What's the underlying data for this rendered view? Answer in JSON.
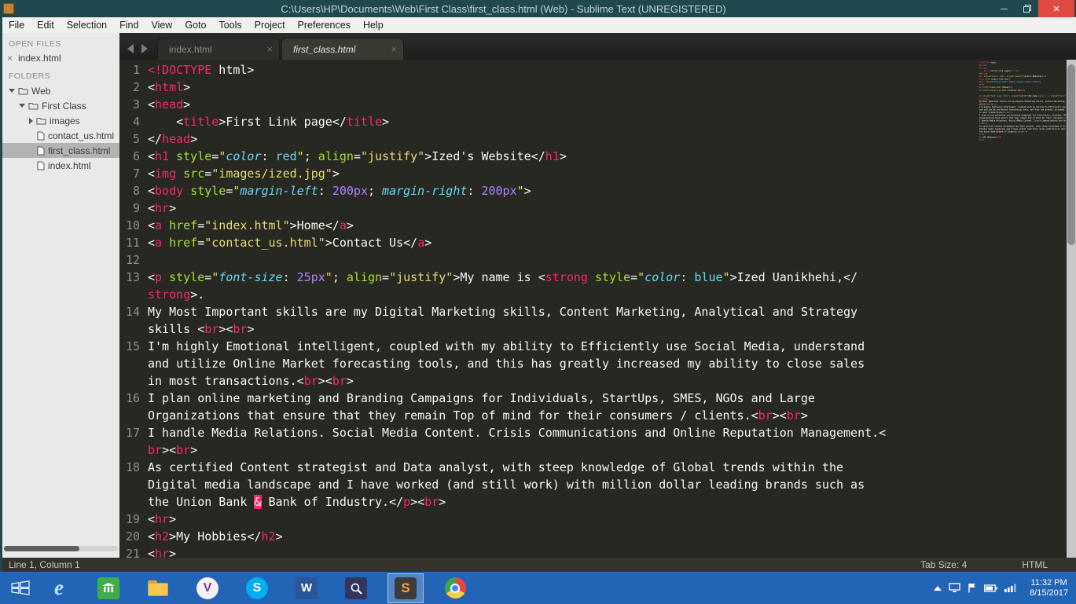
{
  "window": {
    "title": "C:\\Users\\HP\\Documents\\Web\\First Class\\first_class.html (Web) - Sublime Text (UNREGISTERED)"
  },
  "icons": {
    "close": "×",
    "minimize": "─",
    "ie": "e",
    "v_app": "V",
    "skype": "S",
    "word": "W",
    "sublime": "S"
  },
  "menu": {
    "items": [
      "File",
      "Edit",
      "Selection",
      "Find",
      "View",
      "Goto",
      "Tools",
      "Project",
      "Preferences",
      "Help"
    ]
  },
  "sidebar": {
    "open_files_label": "OPEN FILES",
    "open_files": [
      {
        "name": "index.html"
      }
    ],
    "folders_label": "FOLDERS",
    "tree": [
      {
        "label": "Web",
        "type": "folder-open",
        "indent": 0
      },
      {
        "label": "First Class",
        "type": "folder-open",
        "indent": 1
      },
      {
        "label": "images",
        "type": "folder-closed",
        "indent": 2
      },
      {
        "label": "contact_us.html",
        "type": "file",
        "indent": 2
      },
      {
        "label": "first_class.html",
        "type": "file",
        "indent": 2,
        "selected": true
      },
      {
        "label": "index.html",
        "type": "file",
        "indent": 2
      }
    ]
  },
  "tabs": [
    {
      "label": "index.html",
      "active": false
    },
    {
      "label": "first_class.html",
      "active": true
    }
  ],
  "editor": {
    "rows": [
      {
        "num": "1",
        "tokens": [
          [
            "t",
            "<!DOCTYPE"
          ],
          [
            "w",
            " html>"
          ]
        ]
      },
      {
        "num": "2",
        "tokens": [
          [
            "w",
            "<"
          ],
          [
            "t",
            "html"
          ],
          [
            "w",
            ">"
          ]
        ]
      },
      {
        "num": "3",
        "tokens": [
          [
            "w",
            "<"
          ],
          [
            "t",
            "head"
          ],
          [
            "w",
            ">"
          ]
        ]
      },
      {
        "num": "4",
        "tokens": [
          [
            "w",
            "    <"
          ],
          [
            "t",
            "title"
          ],
          [
            "w",
            ">First Link page</"
          ],
          [
            "t",
            "title"
          ],
          [
            "w",
            ">"
          ]
        ]
      },
      {
        "num": "5",
        "tokens": [
          [
            "w",
            "</"
          ],
          [
            "t",
            "head"
          ],
          [
            "w",
            ">"
          ]
        ]
      },
      {
        "num": "6",
        "tokens": [
          [
            "w",
            "<"
          ],
          [
            "t",
            "h1"
          ],
          [
            "w",
            " "
          ],
          [
            "a",
            "style"
          ],
          [
            "w",
            "="
          ],
          [
            "s",
            "\""
          ],
          [
            "c",
            "color"
          ],
          [
            "w",
            ": "
          ],
          [
            "k",
            "red"
          ],
          [
            "s",
            "\""
          ],
          [
            "w",
            "; "
          ],
          [
            "a",
            "align"
          ],
          [
            "w",
            "="
          ],
          [
            "s",
            "\"justify\""
          ],
          [
            "w",
            ">Ized's Website</"
          ],
          [
            "t",
            "h1"
          ],
          [
            "w",
            ">"
          ]
        ]
      },
      {
        "num": "7",
        "tokens": [
          [
            "w",
            "<"
          ],
          [
            "t",
            "img"
          ],
          [
            "w",
            " "
          ],
          [
            "a",
            "src"
          ],
          [
            "w",
            "="
          ],
          [
            "s",
            "\"images/ized.jpg\""
          ],
          [
            "w",
            ">"
          ]
        ]
      },
      {
        "num": "8",
        "tokens": [
          [
            "w",
            "<"
          ],
          [
            "t",
            "body"
          ],
          [
            "w",
            " "
          ],
          [
            "a",
            "style"
          ],
          [
            "w",
            "="
          ],
          [
            "s",
            "\""
          ],
          [
            "c",
            "margin-left"
          ],
          [
            "w",
            ": "
          ],
          [
            "n",
            "200px"
          ],
          [
            "w",
            "; "
          ],
          [
            "c",
            "margin-right"
          ],
          [
            "w",
            ": "
          ],
          [
            "n",
            "200px"
          ],
          [
            "s",
            "\""
          ],
          [
            "w",
            ">"
          ]
        ]
      },
      {
        "num": "9",
        "tokens": [
          [
            "w",
            "<"
          ],
          [
            "t",
            "hr"
          ],
          [
            "w",
            ">"
          ]
        ]
      },
      {
        "num": "10",
        "tokens": [
          [
            "w",
            "<"
          ],
          [
            "t",
            "a"
          ],
          [
            "w",
            " "
          ],
          [
            "a",
            "href"
          ],
          [
            "w",
            "="
          ],
          [
            "s",
            "\"index.html\""
          ],
          [
            "w",
            ">Home</"
          ],
          [
            "t",
            "a"
          ],
          [
            "w",
            ">"
          ]
        ]
      },
      {
        "num": "11",
        "tokens": [
          [
            "w",
            "<"
          ],
          [
            "t",
            "a"
          ],
          [
            "w",
            " "
          ],
          [
            "a",
            "href"
          ],
          [
            "w",
            "="
          ],
          [
            "s",
            "\"contact_us.html\""
          ],
          [
            "w",
            ">Contact Us</"
          ],
          [
            "t",
            "a"
          ],
          [
            "w",
            ">"
          ]
        ]
      },
      {
        "num": "12",
        "tokens": []
      },
      {
        "num": "13",
        "tokens": [
          [
            "w",
            "<"
          ],
          [
            "t",
            "p"
          ],
          [
            "w",
            " "
          ],
          [
            "a",
            "style"
          ],
          [
            "w",
            "="
          ],
          [
            "s",
            "\""
          ],
          [
            "c",
            "font-size"
          ],
          [
            "w",
            ": "
          ],
          [
            "n",
            "25px"
          ],
          [
            "s",
            "\""
          ],
          [
            "w",
            "; "
          ],
          [
            "a",
            "align"
          ],
          [
            "w",
            "="
          ],
          [
            "s",
            "\"justify\""
          ],
          [
            "w",
            ">My name is <"
          ],
          [
            "t",
            "strong"
          ],
          [
            "w",
            " "
          ],
          [
            "a",
            "style"
          ],
          [
            "w",
            "="
          ],
          [
            "s",
            "\""
          ],
          [
            "c",
            "color"
          ],
          [
            "w",
            ": "
          ],
          [
            "k",
            "blue"
          ],
          [
            "s",
            "\""
          ],
          [
            "w",
            ">Ized Uanikhehi,</"
          ]
        ]
      },
      {
        "num": null,
        "tokens": [
          [
            "t",
            "strong"
          ],
          [
            "w",
            ">."
          ]
        ]
      },
      {
        "num": "14",
        "tokens": [
          [
            "w",
            "My Most Important skills are my Digital Marketing skills, Content Marketing, Analytical and Strategy"
          ]
        ]
      },
      {
        "num": null,
        "tokens": [
          [
            "w",
            "skills <"
          ],
          [
            "t",
            "br"
          ],
          [
            "w",
            "><"
          ],
          [
            "t",
            "br"
          ],
          [
            "w",
            ">"
          ]
        ]
      },
      {
        "num": "15",
        "tokens": [
          [
            "w",
            "I'm highly Emotional intelligent, coupled with my ability to Efficiently use Social Media, understand"
          ]
        ]
      },
      {
        "num": null,
        "tokens": [
          [
            "w",
            "and utilize Online Market forecasting tools, and this has greatly increased my ability to close sales"
          ]
        ]
      },
      {
        "num": null,
        "tokens": [
          [
            "w",
            "in most transactions.<"
          ],
          [
            "t",
            "br"
          ],
          [
            "w",
            "><"
          ],
          [
            "t",
            "br"
          ],
          [
            "w",
            ">"
          ]
        ]
      },
      {
        "num": "16",
        "tokens": [
          [
            "w",
            "I plan online marketing and Branding Campaigns for Individuals, StartUps, SMES, NGOs and Large"
          ]
        ]
      },
      {
        "num": null,
        "tokens": [
          [
            "w",
            "Organizations that ensure that they remain Top of mind for their consumers / clients.<"
          ],
          [
            "t",
            "br"
          ],
          [
            "w",
            "><"
          ],
          [
            "t",
            "br"
          ],
          [
            "w",
            ">"
          ]
        ]
      },
      {
        "num": "17",
        "tokens": [
          [
            "w",
            "I handle Media Relations. Social Media Content. Crisis Communications and Online Reputation Management.<"
          ]
        ]
      },
      {
        "num": null,
        "tokens": [
          [
            "t",
            "br"
          ],
          [
            "w",
            "><"
          ],
          [
            "t",
            "br"
          ],
          [
            "w",
            ">"
          ]
        ]
      },
      {
        "num": "18",
        "tokens": [
          [
            "w",
            "As certified Content strategist and Data analyst, with steep knowledge of Global trends within the"
          ]
        ]
      },
      {
        "num": null,
        "tokens": [
          [
            "w",
            "Digital media landscape and I have worked (and still work) with million dollar leading brands such as"
          ]
        ]
      },
      {
        "num": null,
        "tokens": [
          [
            "w",
            "the Union Bank "
          ],
          [
            "i",
            "&"
          ],
          [
            "w",
            " Bank of Industry.</"
          ],
          [
            "t",
            "p"
          ],
          [
            "w",
            "><"
          ],
          [
            "t",
            "br"
          ],
          [
            "w",
            ">"
          ]
        ]
      },
      {
        "num": "19",
        "tokens": [
          [
            "w",
            "<"
          ],
          [
            "t",
            "hr"
          ],
          [
            "w",
            ">"
          ]
        ]
      },
      {
        "num": "20",
        "tokens": [
          [
            "w",
            "<"
          ],
          [
            "t",
            "h2"
          ],
          [
            "w",
            ">My Hobbies</"
          ],
          [
            "t",
            "h2"
          ],
          [
            "w",
            ">"
          ]
        ]
      },
      {
        "num": "21",
        "tokens": [
          [
            "w",
            "<"
          ],
          [
            "t",
            "hr"
          ],
          [
            "w",
            ">"
          ]
        ]
      }
    ]
  },
  "status_bar": {
    "position": "Line 1, Column 1",
    "tab_size": "Tab Size: 4",
    "syntax": "HTML"
  },
  "taskbar": {
    "apps": [
      "start",
      "internet-explorer",
      "green-app",
      "file-explorer",
      "v-app",
      "skype",
      "word",
      "magnifier",
      "sublime-text",
      "chrome"
    ],
    "tray_time": "11:32 PM",
    "tray_date": "8/15/2017"
  },
  "theme": {
    "titlebar": "#20494f",
    "close_button": "#e04a43",
    "taskbar": "#2264b6",
    "editor_bg": "#272822",
    "tag_color": "#f92672",
    "attribute_color": "#a6e22e",
    "string_color": "#e6db74",
    "css_property_color": "#66d9ef",
    "number_color": "#ae81ff"
  }
}
